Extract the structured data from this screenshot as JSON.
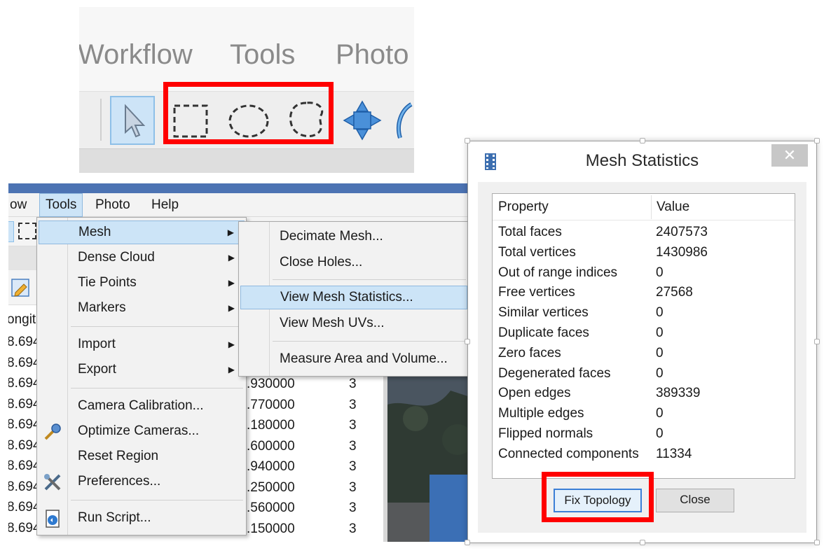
{
  "top_toolbar": {
    "menu": [
      "Workflow",
      "Tools",
      "Photo"
    ],
    "tools": [
      "pointer-icon",
      "rectangle-selection-icon",
      "circle-selection-icon",
      "free-form-selection-icon",
      "navigation-icon",
      "rotate-icon"
    ]
  },
  "app": {
    "menubar": [
      "ow",
      "Tools",
      "Photo",
      "Help"
    ],
    "tools_menu": {
      "items": [
        {
          "label": "Mesh",
          "has_submenu": true,
          "highlighted": true
        },
        {
          "label": "Dense Cloud",
          "has_submenu": true
        },
        {
          "label": "Tie Points",
          "has_submenu": true
        },
        {
          "label": "Markers",
          "has_submenu": true
        },
        {
          "label": "Import",
          "has_submenu": true
        },
        {
          "label": "Export",
          "has_submenu": true
        },
        {
          "label": "Camera Calibration..."
        },
        {
          "label": "Optimize Cameras..."
        },
        {
          "label": "Reset Region"
        },
        {
          "label": "Preferences..."
        },
        {
          "label": "Run Script..."
        }
      ]
    },
    "mesh_submenu": {
      "items": [
        {
          "label": "Decimate Mesh..."
        },
        {
          "label": "Close Holes..."
        },
        {
          "label": "View Mesh Statistics...",
          "highlighted": true
        },
        {
          "label": "View Mesh UVs..."
        },
        {
          "label": "Measure Area and Volume..."
        }
      ]
    },
    "table": {
      "header_fragment": "ongit",
      "left_col": [
        "8.694",
        "8.694",
        "8.694",
        "8.694",
        "8.694",
        "8.694",
        "8.694",
        "8.694",
        "8.694",
        "8.694"
      ],
      "mid_col": [
        ".930000",
        ".770000",
        ".180000",
        ".600000",
        ".940000",
        ".250000",
        ".560000",
        ".150000"
      ],
      "right_col": [
        "3",
        "3",
        "3",
        "3",
        "3",
        "3",
        "3",
        "3"
      ]
    }
  },
  "dialog": {
    "title": "Mesh Statistics",
    "close_glyph": "✕",
    "columns": [
      "Property",
      "Value"
    ],
    "rows": [
      {
        "property": "Total faces",
        "value": "2407573"
      },
      {
        "property": "Total vertices",
        "value": "1430986"
      },
      {
        "property": "Out of range indices",
        "value": "0"
      },
      {
        "property": "Free vertices",
        "value": "27568"
      },
      {
        "property": "Similar vertices",
        "value": "0"
      },
      {
        "property": "Duplicate faces",
        "value": "0"
      },
      {
        "property": "Zero faces",
        "value": "0"
      },
      {
        "property": "Degenerated faces",
        "value": "0"
      },
      {
        "property": "Open edges",
        "value": "389339"
      },
      {
        "property": "Multiple edges",
        "value": "0"
      },
      {
        "property": "Flipped normals",
        "value": "0"
      },
      {
        "property": "Connected components",
        "value": "11334"
      }
    ],
    "buttons": {
      "fix": "Fix Topology",
      "close": "Close"
    }
  },
  "colors": {
    "highlight_red": "#ff0000",
    "menu_hover": "#cce4f7",
    "titlebar_blue": "#4c73b3"
  }
}
